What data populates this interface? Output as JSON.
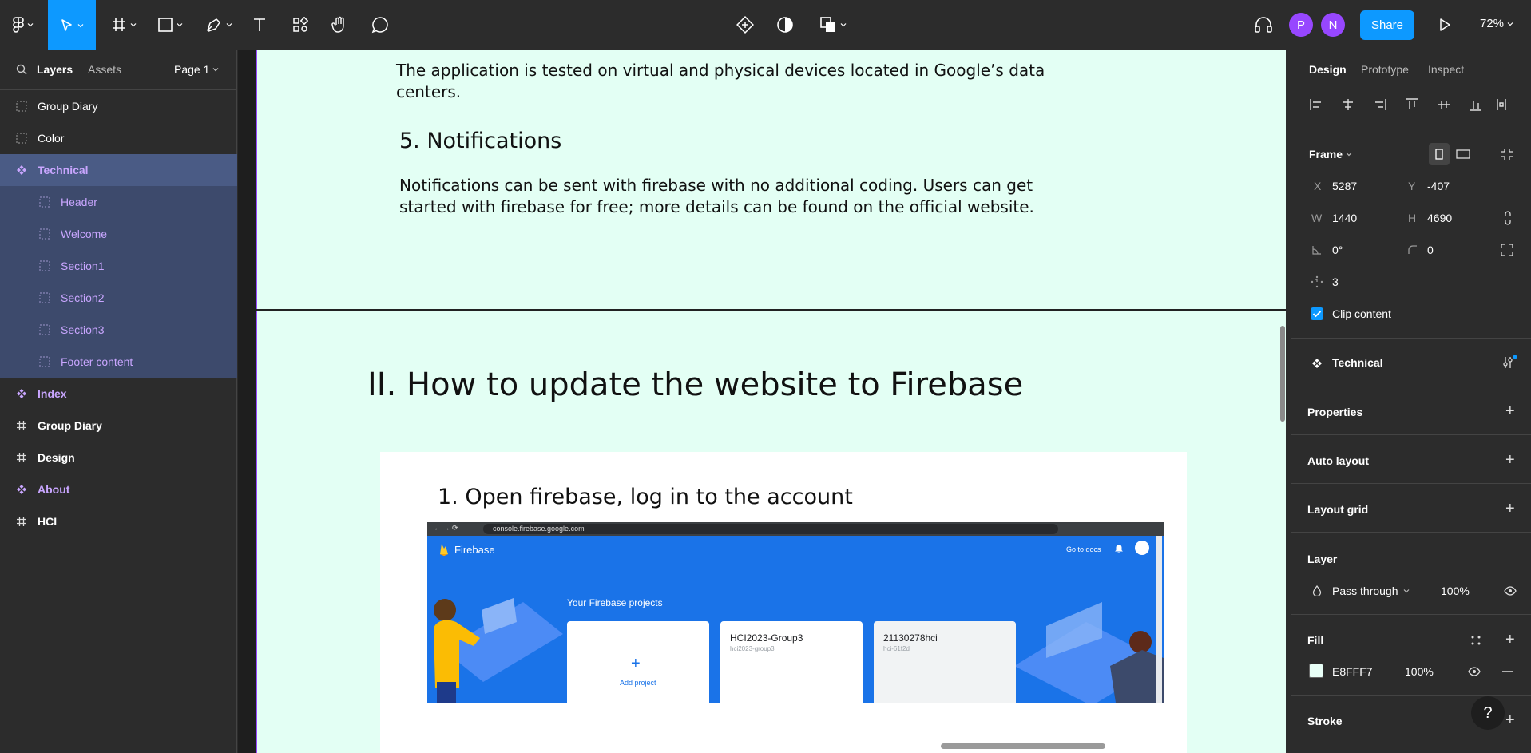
{
  "toolbar": {
    "share_label": "Share",
    "zoom_label": "72%",
    "avatars": [
      "P",
      "N"
    ]
  },
  "layers_panel": {
    "tab_layers": "Layers",
    "tab_assets": "Assets",
    "page_label": "Page 1",
    "items": [
      {
        "label": "Group Diary",
        "kind": "section"
      },
      {
        "label": "Color",
        "kind": "section"
      },
      {
        "label": "Technical",
        "kind": "component"
      },
      {
        "label": "Header",
        "kind": "section"
      },
      {
        "label": "Welcome",
        "kind": "section"
      },
      {
        "label": "Section1",
        "kind": "section"
      },
      {
        "label": "Section2",
        "kind": "section"
      },
      {
        "label": "Section3",
        "kind": "section"
      },
      {
        "label": "Footer content",
        "kind": "section"
      },
      {
        "label": "Index",
        "kind": "component"
      },
      {
        "label": "Group Diary",
        "kind": "frame"
      },
      {
        "label": "Design",
        "kind": "frame"
      },
      {
        "label": "About",
        "kind": "component"
      },
      {
        "label": "HCI",
        "kind": "frame"
      }
    ]
  },
  "canvas": {
    "intro_text": "The application is tested on virtual and physical devices located in Google’s data centers.",
    "notif_heading": "5. Notifications",
    "notif_body": "Notifications can be sent with firebase with no additional coding. Users can get started with firebase for free; more details can be found on the official website.",
    "section_title": "II. How to update the website to Firebase",
    "step_heading": "1. Open firebase, log in to the account",
    "frame_fill": "#E3FFF4",
    "firebase": {
      "url": "console.firebase.google.com",
      "brand": "Firebase",
      "go_to_docs": "Go to docs",
      "projects_title": "Your Firebase projects",
      "add_project": "Add project",
      "projects": [
        {
          "name": "HCI2023-Group3",
          "id": "hci2023-group3"
        },
        {
          "name": "21130278hci",
          "id": "hci-61f2d"
        }
      ]
    }
  },
  "design_panel": {
    "tabs": [
      "Design",
      "Prototype",
      "Inspect"
    ],
    "frame_label": "Frame",
    "x_label": "X",
    "x_value": "5287",
    "y_label": "Y",
    "y_value": "-407",
    "w_label": "W",
    "w_value": "1440",
    "h_label": "H",
    "h_value": "4690",
    "rotation": "0°",
    "radius": "0",
    "spacing": "3",
    "clip_content": "Clip content",
    "component_name": "Technical",
    "properties": "Properties",
    "auto_layout": "Auto layout",
    "layout_grid": "Layout grid",
    "layer": "Layer",
    "blend_mode": "Pass through",
    "layer_opacity": "100%",
    "fill": "Fill",
    "fill_hex": "E8FFF7",
    "fill_opacity": "100%",
    "stroke": "Stroke",
    "help": "?"
  }
}
